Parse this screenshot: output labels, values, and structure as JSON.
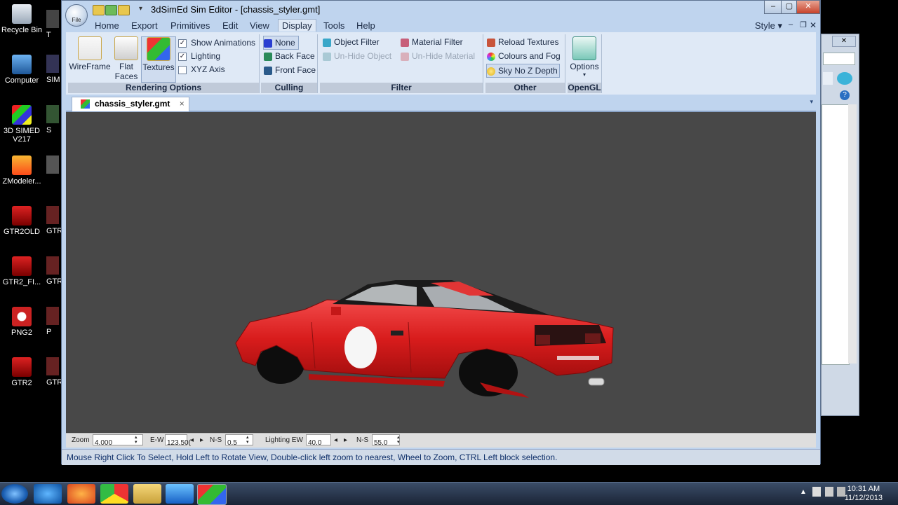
{
  "desktop": {
    "icons": [
      {
        "label": "Recycle Bin"
      },
      {
        "label": "Computer"
      },
      {
        "label": "3D SIMED V217"
      },
      {
        "label": "ZModeler..."
      },
      {
        "label": "GTR2OLD"
      },
      {
        "label": "GTR2_FI..."
      },
      {
        "label": "PNG2"
      },
      {
        "label": "GTR2"
      }
    ],
    "icons2": [
      {
        "label": "T"
      },
      {
        "label": "SIM"
      },
      {
        "label": "S"
      },
      {
        "label": ""
      },
      {
        "label": "GTR"
      },
      {
        "label": "GTR"
      },
      {
        "label": "P"
      },
      {
        "label": "GTR"
      }
    ]
  },
  "window": {
    "title": "3dSimEd Sim Editor - [chassis_styler.gmt]",
    "orb_label": "File",
    "style_menu": "Style",
    "controls": {
      "minimize": "–",
      "maximize": "▢",
      "close": "✕"
    }
  },
  "menu": {
    "items": [
      {
        "label": "Home"
      },
      {
        "label": "Export"
      },
      {
        "label": "Primitives"
      },
      {
        "label": "Edit"
      },
      {
        "label": "View"
      },
      {
        "label": "Display"
      },
      {
        "label": "Tools"
      },
      {
        "label": "Help"
      }
    ],
    "active": "Display"
  },
  "ribbon": {
    "rendering": {
      "label": "Rendering Options",
      "buttons": [
        "WireFrame",
        "Flat Faces",
        "Textures"
      ],
      "checks": [
        {
          "label": "Show Animations",
          "checked": true
        },
        {
          "label": "Lighting",
          "checked": true
        },
        {
          "label": "XYZ Axis",
          "checked": false
        }
      ]
    },
    "culling": {
      "label": "Culling",
      "items": [
        "None",
        "Back Face",
        "Front Face"
      ]
    },
    "filter": {
      "label": "Filter",
      "items": [
        "Object Filter",
        "Un-Hide Object",
        "Material Filter",
        "Un-Hide Material"
      ]
    },
    "other": {
      "label": "Other",
      "items": [
        "Reload Textures",
        "Colours and Fog",
        "Sky No Z Depth"
      ]
    },
    "opengl": {
      "label": "OpenGL",
      "button": "Options"
    }
  },
  "tab": {
    "name": "chassis_styler.gmt",
    "close": "×"
  },
  "controls_bar": {
    "zoom_label": "Zoom",
    "zoom_value": "4.000",
    "ew_label": "E-W",
    "ew_value": "123.50(",
    "ns_label": "N-S",
    "ns_value": "0.5",
    "lighting_label": "Lighting EW",
    "lighting_value": "40.0",
    "ns2_label": "N-S",
    "ns2_value": "55.0"
  },
  "status": "Mouse Right Click To Select, Hold Left to Rotate View, Double-click left  zoom to nearest, Wheel to Zoom, CTRL Left block selection.",
  "taskbar": {
    "time": "10:31 AM",
    "date": "11/12/2013"
  }
}
